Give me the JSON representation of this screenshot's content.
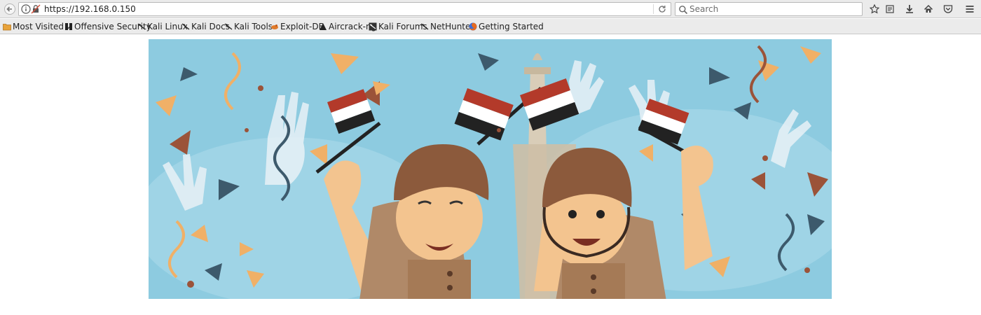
{
  "browser": {
    "url": "https://192.168.0.150",
    "search": {
      "placeholder": "Search"
    }
  },
  "bookmarks": [
    {
      "label": "Most Visited",
      "icon": "folder-icon",
      "has_dropdown": true
    },
    {
      "label": "Offensive Security",
      "icon": "offsec-icon"
    },
    {
      "label": "Kali Linux",
      "icon": "kali-dragon-icon"
    },
    {
      "label": "Kali Docs",
      "icon": "kali-dragon-icon"
    },
    {
      "label": "Kali Tools",
      "icon": "kali-dragon-icon"
    },
    {
      "label": "Exploit-DB",
      "icon": "exploit-db-icon"
    },
    {
      "label": "Aircrack-ng",
      "icon": "aircrack-icon"
    },
    {
      "label": "Kali Forums",
      "icon": "kali-forums-icon"
    },
    {
      "label": "NetHunter",
      "icon": "kali-dragon-icon"
    },
    {
      "label": "Getting Started",
      "icon": "firefox-icon"
    }
  ],
  "toolbar_icons": [
    "star-icon",
    "reading-list-icon",
    "download-icon",
    "home-icon",
    "pocket-icon",
    "menu-icon"
  ],
  "banner": {
    "description_icon": "celebration-illustration",
    "colors": {
      "sky": "#8dcbe0",
      "tan": "#b08968",
      "brown": "#8c5a3c",
      "flag_red": "#b33a2a",
      "flag_black": "#222222"
    }
  }
}
